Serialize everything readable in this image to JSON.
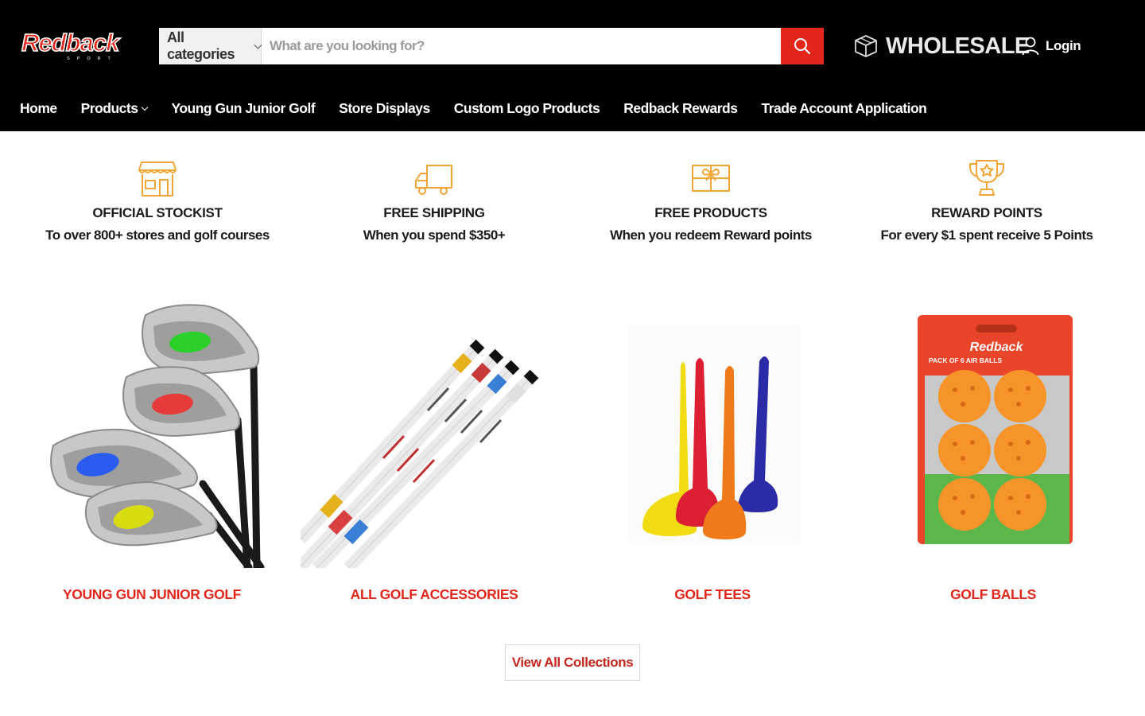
{
  "header": {
    "logo_text": "Redback",
    "logo_subtext": "SPORT",
    "search": {
      "category": "All categories",
      "placeholder": "What are you looking for?"
    },
    "wholesale_label": "WHOLESALE",
    "login_label": "Login"
  },
  "nav": {
    "items": [
      {
        "label": "Home",
        "has_dropdown": false
      },
      {
        "label": "Products",
        "has_dropdown": true
      },
      {
        "label": "Young Gun Junior Golf",
        "has_dropdown": false
      },
      {
        "label": "Store Displays",
        "has_dropdown": false
      },
      {
        "label": "Custom Logo Products",
        "has_dropdown": false
      },
      {
        "label": "Redback Rewards",
        "has_dropdown": false
      },
      {
        "label": "Trade Account Application",
        "has_dropdown": false
      }
    ]
  },
  "features": [
    {
      "icon": "store-icon",
      "title": "OFFICIAL STOCKIST",
      "subtitle": "To over 800+ stores and golf courses"
    },
    {
      "icon": "truck-icon",
      "title": "FREE SHIPPING",
      "subtitle": "When you spend $350+"
    },
    {
      "icon": "gift-icon",
      "title": "FREE PRODUCTS",
      "subtitle": "When you redeem Reward points"
    },
    {
      "icon": "trophy-icon",
      "title": "REWARD POINTS",
      "subtitle": "For every $1 spent receive 5 Points"
    }
  ],
  "collections": [
    {
      "name": "YOUNG GUN JUNIOR GOLF",
      "image": "junior-golf-irons"
    },
    {
      "name": "ALL GOLF ACCESSORIES",
      "image": "alignment-sticks"
    },
    {
      "name": "GOLF TEES",
      "image": "golf-tees"
    },
    {
      "name": "GOLF BALLS",
      "image": "air-balls-pack",
      "packaging": {
        "brand": "Redback",
        "text": "PACK OF 6 AIR BALLS"
      }
    }
  ],
  "view_all_label": "View All Collections",
  "colors": {
    "brand_red": "#e2261c",
    "header_bg": "#000000",
    "feature_icon": "#f0a636"
  }
}
